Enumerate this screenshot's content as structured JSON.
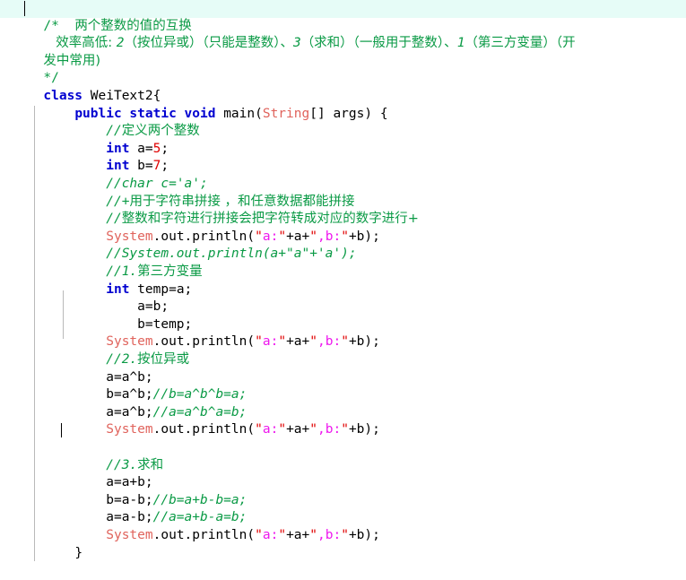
{
  "window": {
    "kind": "code-editor",
    "language": "Java",
    "background": "#ffffff",
    "current_line_highlight": "#e6fcf7",
    "indent_guide_color": "#b9b9b9"
  },
  "colors": {
    "keyword": "#0000d0",
    "type": "#e0635c",
    "number": "#e00000",
    "string_quote": "#e00000",
    "string_body": "#ee18ee",
    "comment": "#0a9a45",
    "plain": "#000000"
  },
  "code": {
    "lines": [
      {
        "n": 1,
        "highlight": true,
        "caret": true,
        "text": "/*  两个整数的值的互换"
      },
      {
        "n": 2,
        "highlight": false,
        "text": "    效率高低: 2（按位异或）（只能是整数）、3（求和）（一般用于整数）、1（第三方变量）（开"
      },
      {
        "n": 3,
        "highlight": false,
        "text": "发中常用)"
      },
      {
        "n": 4,
        "highlight": false,
        "text": "*/"
      },
      {
        "n": 5,
        "highlight": false,
        "text": "class WeiText2{"
      },
      {
        "n": 6,
        "highlight": false,
        "text": "    public static void main(String[] args) {"
      },
      {
        "n": 7,
        "highlight": false,
        "text": "        //定义两个整数"
      },
      {
        "n": 8,
        "highlight": false,
        "text": "        int a=5;"
      },
      {
        "n": 9,
        "highlight": false,
        "text": "        int b=7;"
      },
      {
        "n": 10,
        "highlight": false,
        "text": "        //char c='a';"
      },
      {
        "n": 11,
        "highlight": false,
        "text": "        //+用于字符串拼接 ，和任意数据都能拼接"
      },
      {
        "n": 12,
        "highlight": false,
        "text": "        //整数和字符进行拼接会把字符转成对应的数字进行+"
      },
      {
        "n": 13,
        "highlight": false,
        "text": "        System.out.println(\"a:\"+a+\",b:\"+b);"
      },
      {
        "n": 14,
        "highlight": false,
        "text": "        //System.out.println(a+\"a\"+'a');"
      },
      {
        "n": 15,
        "highlight": false,
        "text": "        //1.第三方变量"
      },
      {
        "n": 16,
        "highlight": false,
        "text": "        int temp=a;"
      },
      {
        "n": 17,
        "highlight": false,
        "text": "            a=b;"
      },
      {
        "n": 18,
        "highlight": false,
        "text": "            b=temp;"
      },
      {
        "n": 19,
        "highlight": false,
        "text": "        System.out.println(\"a:\"+a+\",b:\"+b);"
      },
      {
        "n": 20,
        "highlight": false,
        "text": "        //2.按位异或"
      },
      {
        "n": 21,
        "highlight": false,
        "text": "        a=a^b;"
      },
      {
        "n": 22,
        "highlight": false,
        "text": "        b=a^b;//b=a^b^b=a;"
      },
      {
        "n": 23,
        "highlight": false,
        "text": "        a=a^b;//a=a^b^a=b;"
      },
      {
        "n": 24,
        "highlight": false,
        "text": "        System.out.println(\"a:\"+a+\",b:\"+b);"
      },
      {
        "n": 25,
        "highlight": false,
        "caret": true,
        "text": "        "
      },
      {
        "n": 26,
        "highlight": false,
        "text": "        //3.求和"
      },
      {
        "n": 27,
        "highlight": false,
        "text": "        a=a+b;"
      },
      {
        "n": 28,
        "highlight": false,
        "text": "        b=a-b;//b=a+b-b=a;"
      },
      {
        "n": 29,
        "highlight": false,
        "text": "        a=a-b;//a=a+b-a=b;"
      },
      {
        "n": 30,
        "highlight": false,
        "text": "        System.out.println(\"a:\"+a+\",b:\"+b);"
      },
      {
        "n": 31,
        "highlight": false,
        "text": "    }"
      }
    ],
    "block_comment_header": "/*",
    "block_comment_title": "两个整数的值的互换",
    "block_comment_body_prefix": "效率高低:",
    "efficiency_ranks": [
      {
        "rank": "2",
        "method": "（按位异或）",
        "note": "（只能是整数）"
      },
      {
        "rank": "3",
        "method": "（求和）",
        "note": "（一般用于整数）"
      },
      {
        "rank": "1",
        "method": "（第三方变量）",
        "note": "（开发中常用)"
      }
    ],
    "block_comment_end": "*/",
    "class_keyword": "class",
    "class_name": "WeiText2",
    "method_modifiers": "public static void",
    "method_name": "main",
    "method_param_type": "String",
    "method_param_name": "args",
    "variables": [
      {
        "type": "int",
        "name": "a",
        "value": "5"
      },
      {
        "type": "int",
        "name": "b",
        "value": "7"
      },
      {
        "type": "int",
        "name": "temp",
        "value": "a"
      }
    ],
    "print_string_a": "a:",
    "print_string_b": ",b:",
    "closing_brace": "}"
  }
}
